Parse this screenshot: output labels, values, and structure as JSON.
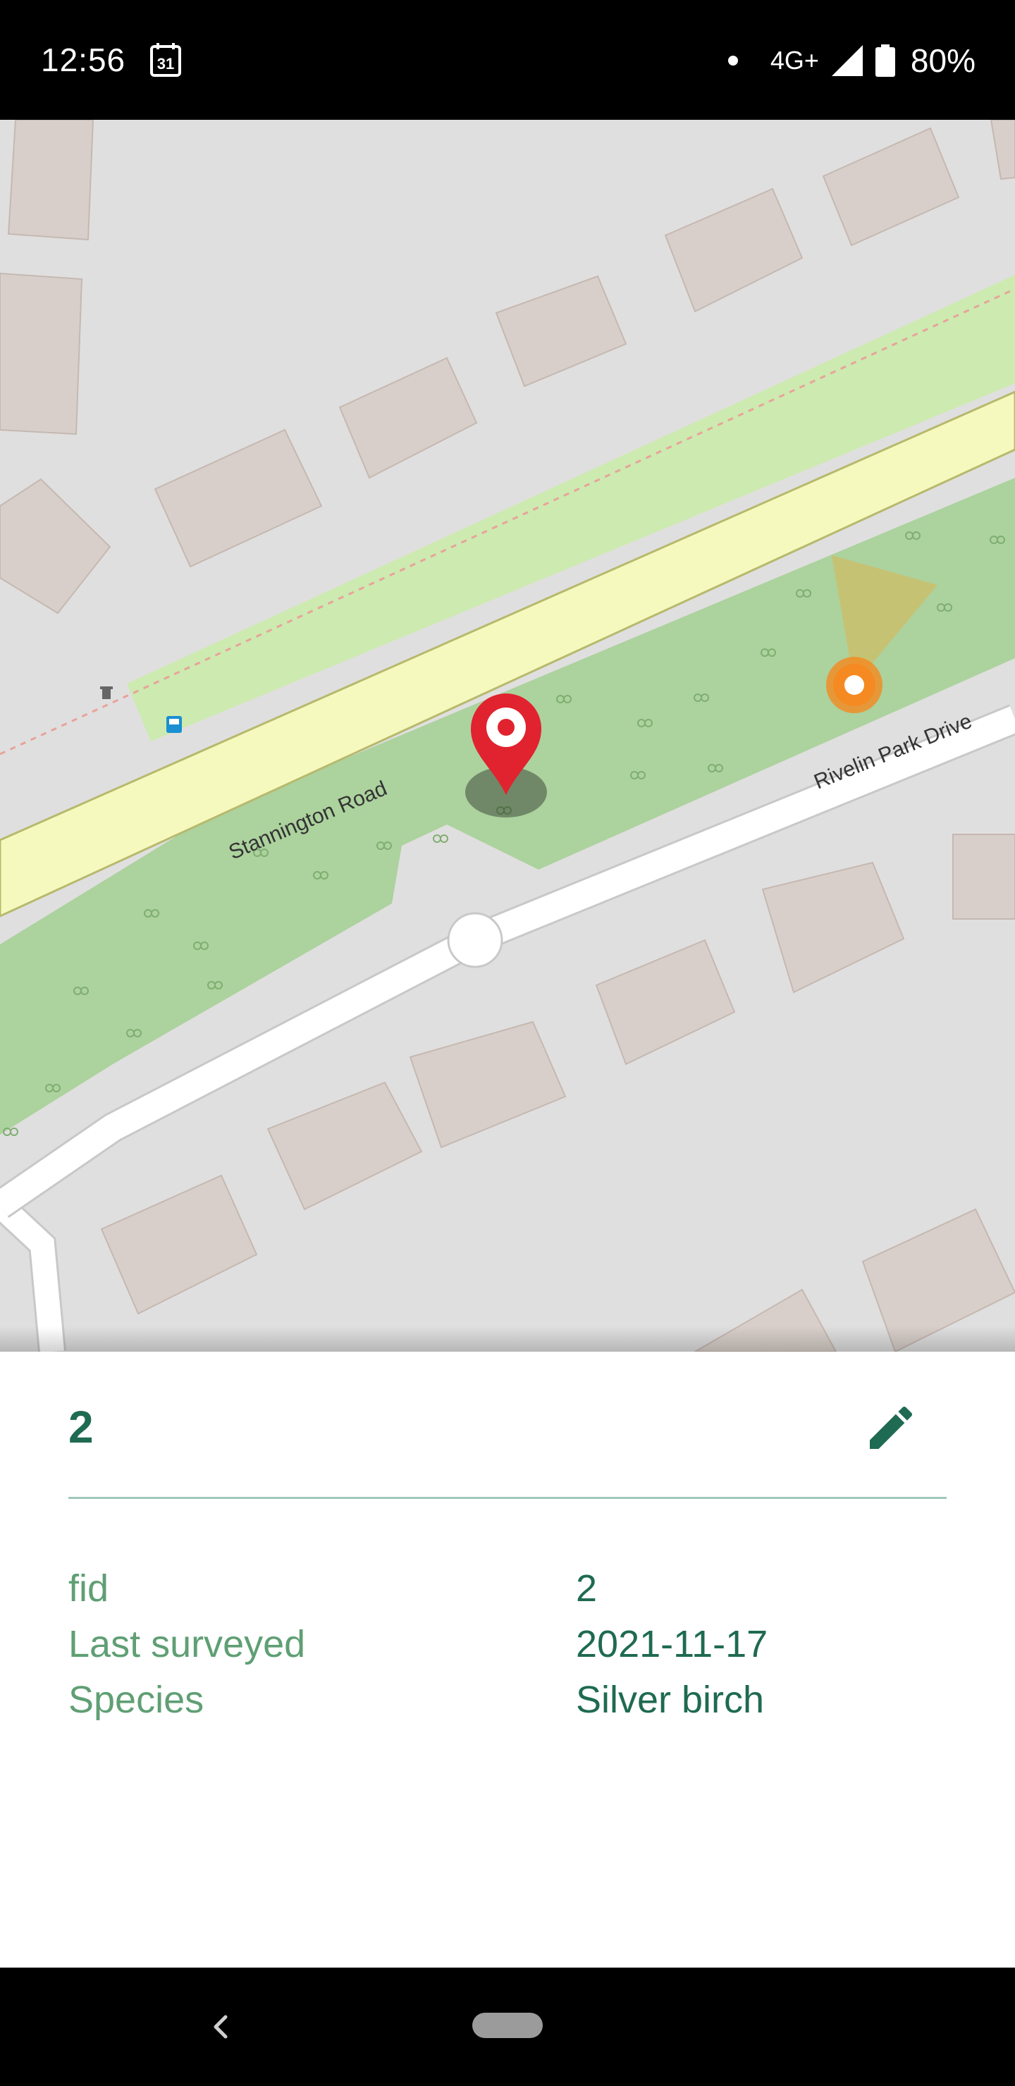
{
  "status_bar": {
    "time": "12:56",
    "calendar_day": "31",
    "network": "4G+",
    "battery": "80%",
    "icons": [
      "calendar-icon",
      "dot-icon",
      "signal-icon",
      "battery-icon"
    ]
  },
  "map": {
    "labels": {
      "road_1": "Stannington Road",
      "road_2": "Rivelin Park Drive"
    },
    "colors": {
      "background": "#e0dfdf",
      "building": "#d8cfca",
      "park": "#acd29e",
      "verge": "#cdeab0",
      "main_road": "#f6f9be",
      "road_outline": "#b7b96d",
      "residential_road": "#ffffff",
      "marker_red": "#e0232e",
      "location_orange": "#f5891f"
    },
    "markers": [
      "selected-feature-marker",
      "current-location-icon"
    ]
  },
  "feature": {
    "title": "2",
    "edit_icon": "pencil-icon",
    "attributes": [
      {
        "key": "fid",
        "value": "2"
      },
      {
        "key": "Last surveyed",
        "value": "2021-11-17"
      },
      {
        "key": "Species",
        "value": "Silver birch"
      }
    ],
    "colors": {
      "title": "#1f6a52",
      "key": "#5f9f74",
      "divider": "#9fc8b8"
    }
  },
  "nav_bar": {
    "icons": [
      "back-icon",
      "home-pill"
    ]
  }
}
